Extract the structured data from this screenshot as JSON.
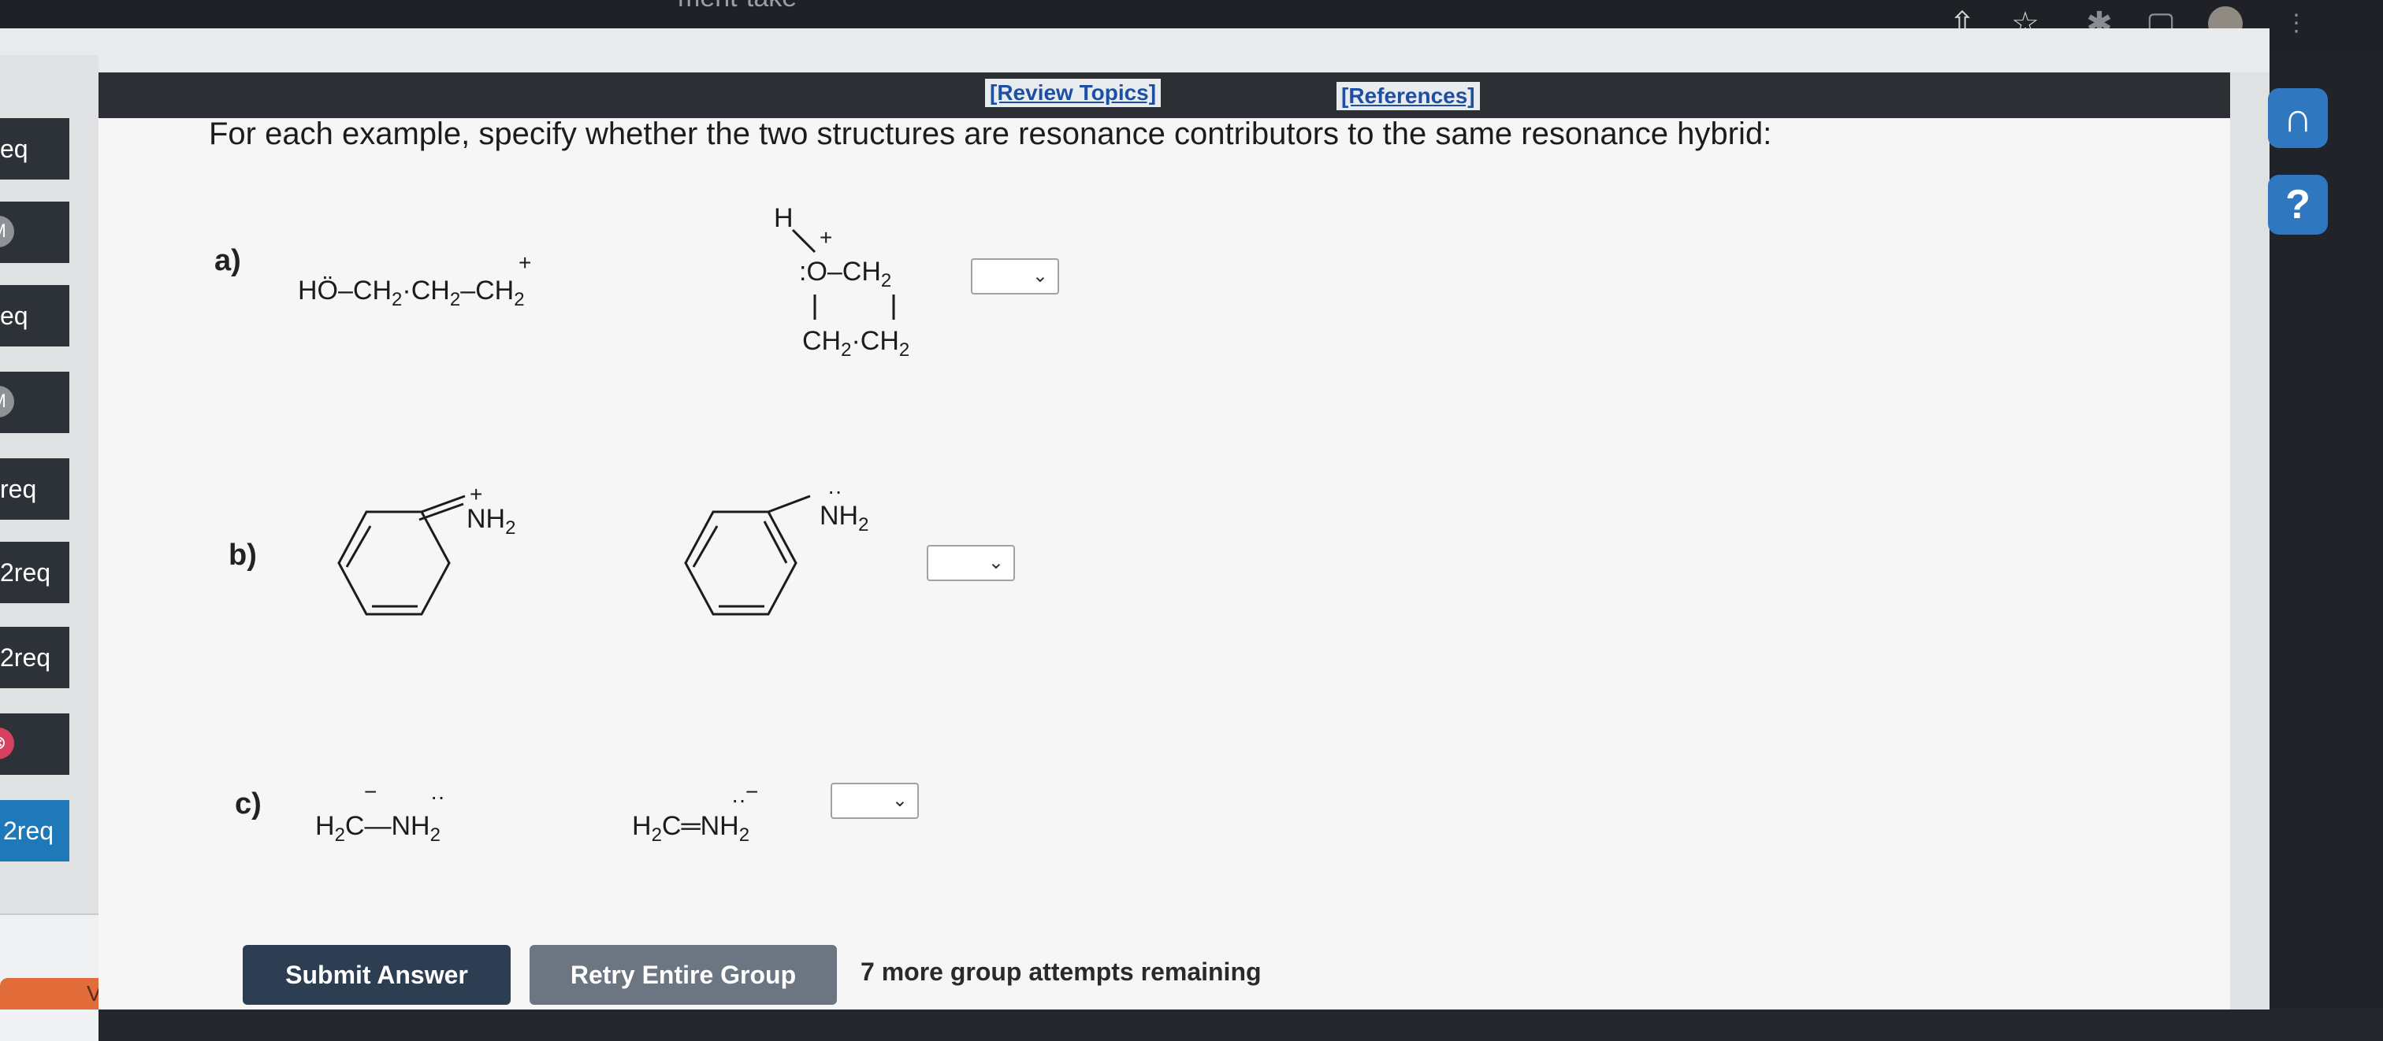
{
  "browser": {
    "url_fragment": "ment-take",
    "share_icon": "⇧",
    "star_icon": "☆"
  },
  "sidebar": {
    "items": [
      {
        "label": "eq",
        "badge": ""
      },
      {
        "label": "",
        "badge": "M"
      },
      {
        "label": "eq",
        "badge": ""
      },
      {
        "label": "",
        "badge": "M"
      },
      {
        "label": "req",
        "badge": ""
      },
      {
        "label": "2req",
        "badge": ""
      },
      {
        "label": "2req",
        "badge": ""
      },
      {
        "label": "",
        "badge": "⊗"
      },
      {
        "label": "2req",
        "badge": ""
      }
    ],
    "visited_label": "Visited",
    "collapse_icon": "<"
  },
  "header": {
    "review_topics": "[Review Topics]",
    "references": "[References]"
  },
  "question": {
    "prompt": "For each example, specify whether the two structures are resonance contributors to the same resonance hybrid:"
  },
  "parts": [
    {
      "label": "a)",
      "dropdown_value": ""
    },
    {
      "label": "b)",
      "dropdown_value": ""
    },
    {
      "label": "c)",
      "dropdown_value": ""
    }
  ],
  "structures": {
    "a_left": {
      "ho": "HÖ",
      "chain": "–CH",
      "sub2": "2",
      "dot": "·",
      "ch": "CH",
      "dash": "–",
      "plus": "+"
    },
    "a_right": {
      "h": "H",
      "plus": "+",
      "o": ":O–CH",
      "sub2": "2",
      "bottom": "CH",
      "mid": "·CH",
      "lp": "··"
    },
    "b_left": {
      "nh": "NH",
      "sub2": "2",
      "plus": "+"
    },
    "b_right": {
      "nh": "NH",
      "sub2": "2",
      "lp": "··"
    },
    "c_left": {
      "h2c": "H",
      "sub2": "2",
      "c": "C",
      "bond": "—",
      "nh": "NH",
      "minus": "−",
      "lp": "··"
    },
    "c_right": {
      "h2c": "H",
      "sub2": "2",
      "c": "C",
      "bond": "═",
      "nh": "NH",
      "minus": "−",
      "lp": "··"
    }
  },
  "actions": {
    "submit": "Submit Answer",
    "retry": "Retry Entire Group",
    "attempts": "7 more group attempts remaining"
  },
  "right_panel": {
    "headset_icon": "headset-icon",
    "help_label": "?"
  }
}
